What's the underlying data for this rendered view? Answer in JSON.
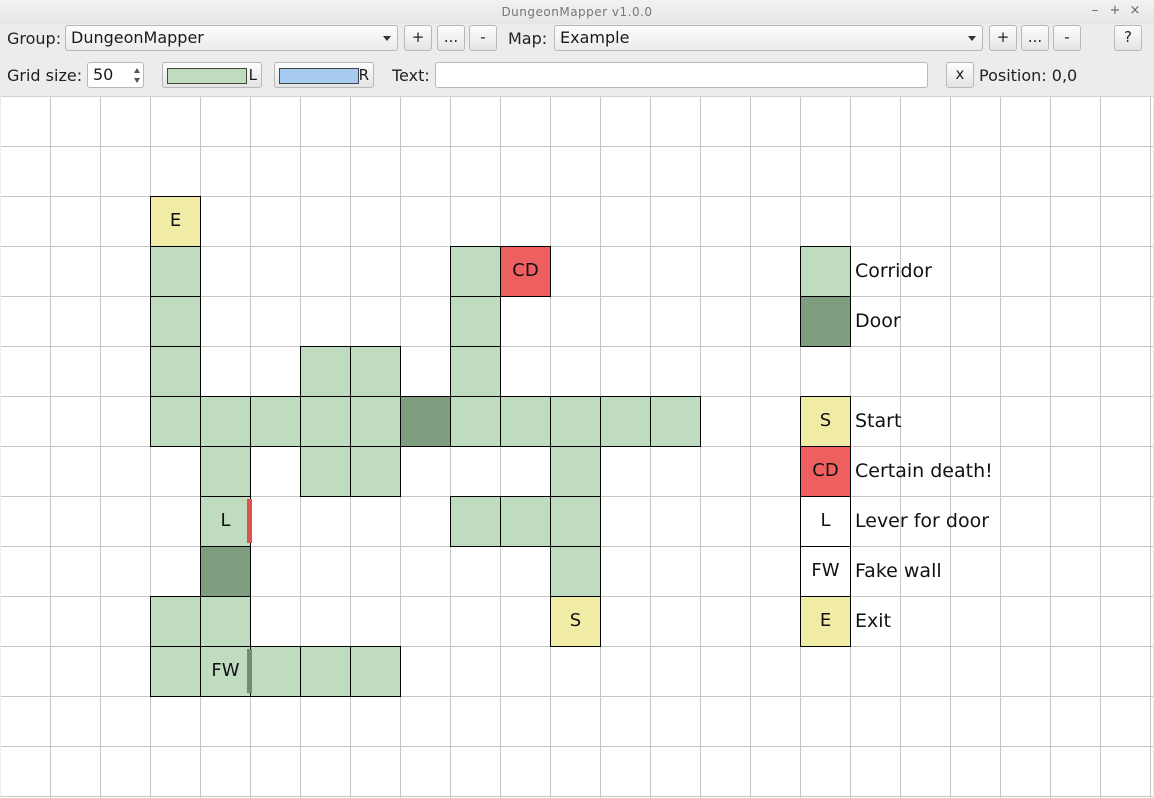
{
  "window": {
    "title": "DungeonMapper v1.0.0"
  },
  "window_controls": {
    "minimize": "–",
    "maximize": "+",
    "close": "×"
  },
  "toolbar1": {
    "group_label": "Group:",
    "group_value": "DungeonMapper",
    "group_add": "+",
    "group_more": "...",
    "group_remove": "-",
    "map_label": "Map:",
    "map_value": "Example",
    "map_add": "+",
    "map_more": "...",
    "map_remove": "-",
    "help": "?"
  },
  "toolbar2": {
    "grid_size_label": "Grid size:",
    "grid_size_value": "50",
    "left_color_tag": "L",
    "left_color": "#c0dcc0",
    "right_color_tag": "R",
    "right_color": "#a6caf0",
    "text_label": "Text:",
    "text_value": "",
    "clear_button": "x",
    "position_text": "Position: 0,0"
  },
  "colors": {
    "corridor": "#c0dcc0",
    "door": "#7f9e7f",
    "yellow": "#f0eca6",
    "death": "#ee6060",
    "lever_wall": "#e05050",
    "fake_wall": "#6e8e6e",
    "grid_line": "#c6c6c6",
    "white": "#ffffff"
  },
  "map": {
    "cells": [
      {
        "col": 3,
        "row": 2,
        "color": "yellow",
        "text": "E"
      },
      {
        "col": 3,
        "row": 3,
        "color": "corridor",
        "text": ""
      },
      {
        "col": 9,
        "row": 3,
        "color": "corridor",
        "text": ""
      },
      {
        "col": 10,
        "row": 3,
        "color": "death",
        "text": "CD"
      },
      {
        "col": 3,
        "row": 4,
        "color": "corridor",
        "text": ""
      },
      {
        "col": 9,
        "row": 4,
        "color": "corridor",
        "text": ""
      },
      {
        "col": 3,
        "row": 5,
        "color": "corridor",
        "text": ""
      },
      {
        "col": 6,
        "row": 5,
        "color": "corridor",
        "text": ""
      },
      {
        "col": 7,
        "row": 5,
        "color": "corridor",
        "text": ""
      },
      {
        "col": 9,
        "row": 5,
        "color": "corridor",
        "text": ""
      },
      {
        "col": 3,
        "row": 6,
        "color": "corridor",
        "text": ""
      },
      {
        "col": 4,
        "row": 6,
        "color": "corridor",
        "text": ""
      },
      {
        "col": 5,
        "row": 6,
        "color": "corridor",
        "text": ""
      },
      {
        "col": 6,
        "row": 6,
        "color": "corridor",
        "text": ""
      },
      {
        "col": 7,
        "row": 6,
        "color": "corridor",
        "text": ""
      },
      {
        "col": 8,
        "row": 6,
        "color": "door",
        "text": ""
      },
      {
        "col": 9,
        "row": 6,
        "color": "corridor",
        "text": ""
      },
      {
        "col": 10,
        "row": 6,
        "color": "corridor",
        "text": ""
      },
      {
        "col": 11,
        "row": 6,
        "color": "corridor",
        "text": ""
      },
      {
        "col": 12,
        "row": 6,
        "color": "corridor",
        "text": ""
      },
      {
        "col": 13,
        "row": 6,
        "color": "corridor",
        "text": ""
      },
      {
        "col": 4,
        "row": 7,
        "color": "corridor",
        "text": ""
      },
      {
        "col": 6,
        "row": 7,
        "color": "corridor",
        "text": ""
      },
      {
        "col": 7,
        "row": 7,
        "color": "corridor",
        "text": ""
      },
      {
        "col": 11,
        "row": 7,
        "color": "corridor",
        "text": ""
      },
      {
        "col": 4,
        "row": 8,
        "color": "corridor",
        "text": "L"
      },
      {
        "col": 9,
        "row": 8,
        "color": "corridor",
        "text": ""
      },
      {
        "col": 10,
        "row": 8,
        "color": "corridor",
        "text": ""
      },
      {
        "col": 11,
        "row": 8,
        "color": "corridor",
        "text": ""
      },
      {
        "col": 4,
        "row": 9,
        "color": "door",
        "text": ""
      },
      {
        "col": 11,
        "row": 9,
        "color": "corridor",
        "text": ""
      },
      {
        "col": 3,
        "row": 10,
        "color": "corridor",
        "text": ""
      },
      {
        "col": 4,
        "row": 10,
        "color": "corridor",
        "text": ""
      },
      {
        "col": 11,
        "row": 10,
        "color": "yellow",
        "text": "S"
      },
      {
        "col": 3,
        "row": 11,
        "color": "corridor",
        "text": ""
      },
      {
        "col": 4,
        "row": 11,
        "color": "corridor",
        "text": "FW"
      },
      {
        "col": 5,
        "row": 11,
        "color": "corridor",
        "text": ""
      },
      {
        "col": 6,
        "row": 11,
        "color": "corridor",
        "text": ""
      },
      {
        "col": 7,
        "row": 11,
        "color": "corridor",
        "text": ""
      }
    ],
    "walls": [
      {
        "col": 4,
        "row": 8,
        "side": "right",
        "color": "lever_wall"
      },
      {
        "col": 4,
        "row": 11,
        "side": "right",
        "color": "fake_wall"
      }
    ]
  },
  "legend": [
    {
      "row": 3,
      "color": "corridor",
      "text": "",
      "label": "Corridor"
    },
    {
      "row": 4,
      "color": "door",
      "text": "",
      "label": "Door"
    },
    {
      "row": 6,
      "color": "yellow",
      "text": "S",
      "label": "Start"
    },
    {
      "row": 7,
      "color": "death",
      "text": "CD",
      "label": "Certain death!"
    },
    {
      "row": 8,
      "color": "white",
      "text": "L",
      "label": "Lever for door"
    },
    {
      "row": 9,
      "color": "white",
      "text": "FW",
      "label": "Fake wall"
    },
    {
      "row": 10,
      "color": "yellow",
      "text": "E",
      "label": "Exit"
    }
  ]
}
